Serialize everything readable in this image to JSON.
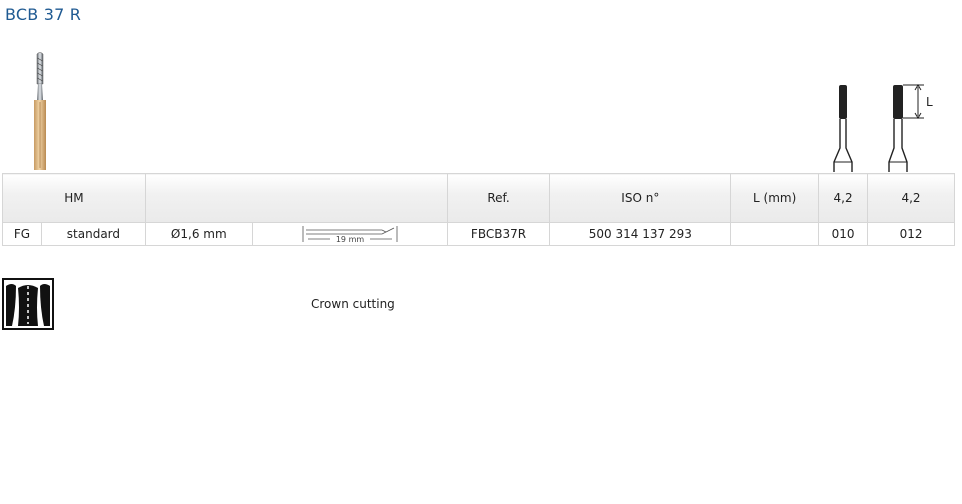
{
  "title": "BCB 37 R",
  "table": {
    "header": {
      "material": "HM",
      "col2": "",
      "ref": "Ref.",
      "iso": "ISO n°",
      "length": "L (mm)",
      "l_value_1": "4,2",
      "l_value_2": "4,2"
    },
    "row": {
      "shank": "FG",
      "type": "standard",
      "shank_diameter": "Ø1,6 mm",
      "shank_length": "19 mm",
      "ref": "FBCB37R",
      "iso": "500 314 137 293",
      "length": "",
      "size_1": "010",
      "size_2": "012"
    }
  },
  "profile_label": "L",
  "description": "Crown cutting",
  "colors": {
    "title": "#1f5a92",
    "shank_gold": "#d9b080",
    "border": "#d6d6d6"
  },
  "icons": {
    "bur": "bur-photo-icon",
    "crown": "crown-cutting-icon"
  }
}
